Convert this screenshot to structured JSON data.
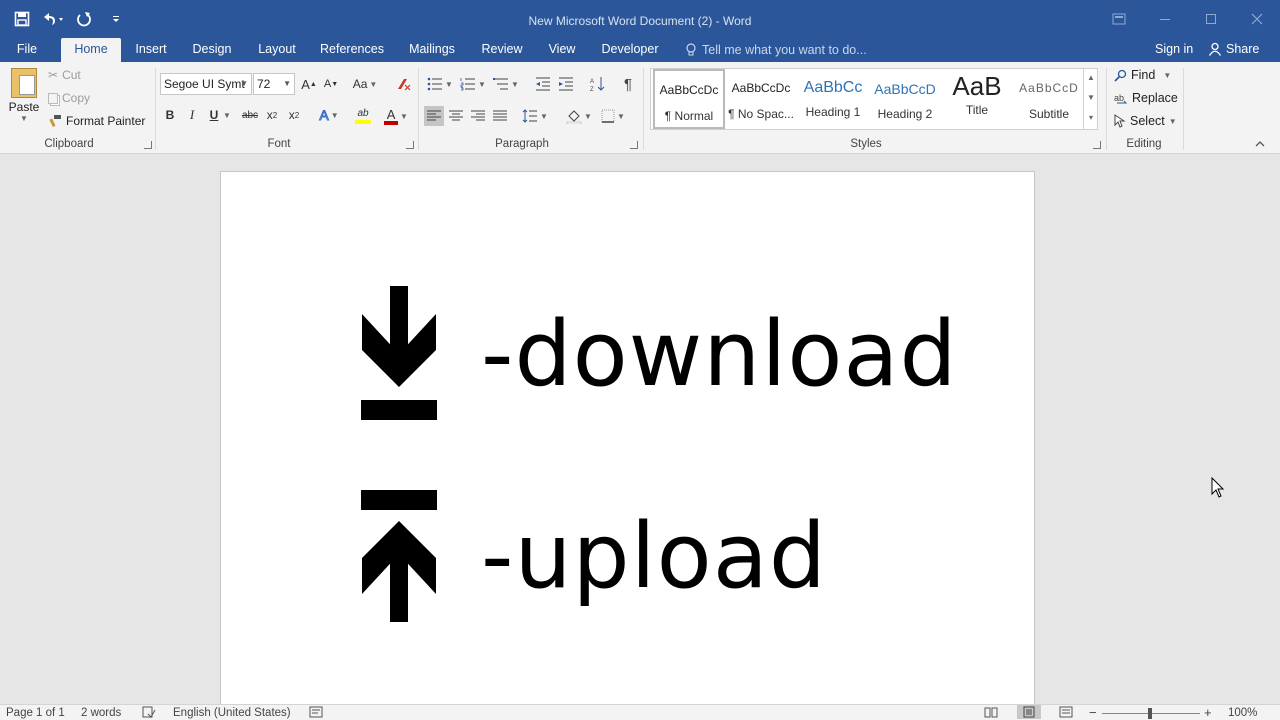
{
  "window": {
    "title": "New Microsoft Word Document (2) - Word"
  },
  "tabs": [
    {
      "label": "File"
    },
    {
      "label": "Home"
    },
    {
      "label": "Insert"
    },
    {
      "label": "Design"
    },
    {
      "label": "Layout"
    },
    {
      "label": "References"
    },
    {
      "label": "Mailings"
    },
    {
      "label": "Review"
    },
    {
      "label": "View"
    },
    {
      "label": "Developer"
    }
  ],
  "active_tab": "Home",
  "tell_me": {
    "placeholder": "Tell me what you want to do..."
  },
  "account": {
    "sign_in": "Sign in",
    "share": "Share"
  },
  "ribbon": {
    "clipboard": {
      "label": "Clipboard",
      "paste": "Paste",
      "cut": "Cut",
      "copy": "Copy",
      "format_painter": "Format Painter"
    },
    "font": {
      "label": "Font",
      "family": "Segoe UI Symt",
      "size": "72",
      "grow": "A",
      "shrink": "A",
      "change_case": "Aa",
      "bold": "B",
      "italic": "I",
      "underline": "U",
      "strikethrough": "abc",
      "subscript": "x",
      "superscript": "x",
      "text_effects": "A",
      "highlight": "ab",
      "font_color": "A"
    },
    "paragraph": {
      "label": "Paragraph"
    },
    "styles": {
      "label": "Styles",
      "items": [
        {
          "sample": "AaBbCcDc",
          "name": "¶ Normal"
        },
        {
          "sample": "AaBbCcDc",
          "name": "¶ No Spac..."
        },
        {
          "sample": "AaBbCc",
          "name": "Heading 1"
        },
        {
          "sample": "AaBbCcD",
          "name": "Heading 2"
        },
        {
          "sample": "AaB",
          "name": "Title"
        },
        {
          "sample": "AaBbCcD",
          "name": "Subtitle"
        }
      ]
    },
    "editing": {
      "label": "Editing",
      "find": "Find",
      "replace": "Replace",
      "select": "Select"
    }
  },
  "document": {
    "lines": [
      {
        "symbol": "download-arrow",
        "text": "-download"
      },
      {
        "symbol": "upload-arrow",
        "text": "-upload"
      }
    ]
  },
  "status": {
    "page": "Page 1 of 1",
    "words": "2 words",
    "language": "English (United States)",
    "zoom": "100%",
    "zoom_level": 1.0
  },
  "colors": {
    "accent": "#2b579a",
    "heading": "#2e74b5"
  }
}
